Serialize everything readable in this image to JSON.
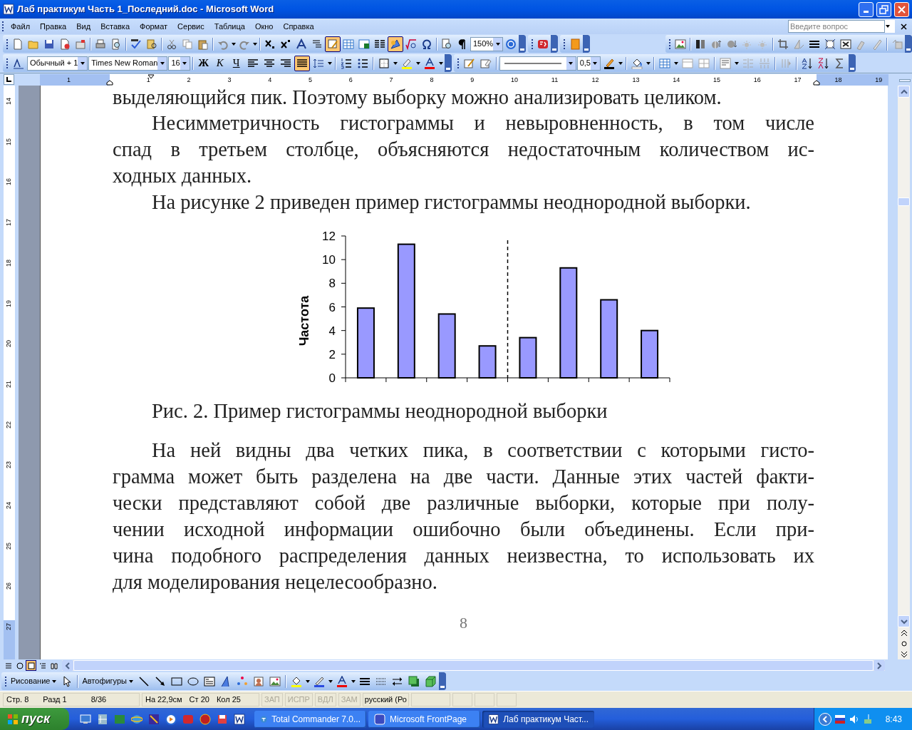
{
  "window": {
    "title": "Лаб практикум Часть 1_Последний.doc - Microsoft Word"
  },
  "menu": [
    {
      "label": "Файл"
    },
    {
      "label": "Правка"
    },
    {
      "label": "Вид"
    },
    {
      "label": "Вставка"
    },
    {
      "label": "Формат"
    },
    {
      "label": "Сервис"
    },
    {
      "label": "Таблица"
    },
    {
      "label": "Окно"
    },
    {
      "label": "Справка"
    }
  ],
  "help_search": {
    "placeholder": "Введите вопрос"
  },
  "standard_toolbar": {
    "zoom": "150%",
    "tables_and_borders_pressed": true,
    "drawing_pressed": true
  },
  "formatting_toolbar": {
    "style": "Обычный + 1",
    "font": "Times New Roman",
    "size": "16",
    "bold": "Ж",
    "italic": "К",
    "underline": "Ч",
    "justify_pressed": true
  },
  "tables_toolbar": {
    "line_weight": "0,5"
  },
  "ruler": {
    "horizontal": [
      "1",
      "1",
      "2",
      "3",
      "4",
      "5",
      "6",
      "7",
      "8",
      "9",
      "10",
      "11",
      "12",
      "13",
      "14",
      "15",
      "16",
      "17",
      "18",
      "19"
    ],
    "vertical": [
      "14",
      "15",
      "16",
      "17",
      "18",
      "19",
      "20",
      "21",
      "22",
      "23",
      "24",
      "25",
      "26",
      "27"
    ]
  },
  "document": {
    "paragraphs_before": [
      {
        "indent": false,
        "lines": [
          "выделяющийся пик. Поэтому выборку можно анализировать целиком."
        ]
      },
      {
        "indent": true,
        "lines": [
          "Несимметричность гистограммы и невыровненность, в том числе",
          "спад в третьем столбце, объясняются недостаточным количеством ис-",
          "ходных данных."
        ]
      },
      {
        "indent": true,
        "lines": [
          "На рисунке 2 приведен пример гистограммы неоднородной выборки."
        ]
      }
    ],
    "chart_data": {
      "type": "bar",
      "ylabel": "Частота",
      "values": [
        5.9,
        11.3,
        5.4,
        2.7,
        3.4,
        9.3,
        6.6,
        4.0
      ],
      "ylim": [
        0,
        12
      ],
      "yticks": [
        0,
        2,
        4,
        6,
        8,
        10,
        12
      ]
    },
    "caption": "Рис. 2. Пример гистограммы неоднородной выборки",
    "paragraphs_after": [
      {
        "indent": true,
        "lines": [
          "На ней видны два четких пика, в соответствии с которыми гисто-",
          "грамма может быть разделена на две части. Данные этих частей факти-",
          "чески представляют собой две различные выборки, которые при полу-",
          "чении исходной информации ошибочно были объединены. Если при-",
          "чина подобного распределения данных неизвестна, то использовать их",
          "для моделирования нецелесообразно."
        ]
      }
    ],
    "page_number": "8"
  },
  "view_buttons": [
    {
      "selected": false
    },
    {
      "selected": false
    },
    {
      "selected": true
    },
    {
      "selected": false
    },
    {
      "selected": false
    }
  ],
  "drawing_toolbar": {
    "draw_menu": "Рисование",
    "autoshapes": "Автофигуры"
  },
  "status_bar": {
    "position": [
      "Стр. 8",
      "Разд 1",
      "8/36"
    ],
    "cursor": [
      "На 22,9см",
      "Ст 20",
      "Кол 25"
    ],
    "modes": [
      {
        "label": "ЗАП",
        "on": false
      },
      {
        "label": "ИСПР",
        "on": false
      },
      {
        "label": "ВДЛ",
        "on": false
      },
      {
        "label": "ЗАМ",
        "on": false
      }
    ],
    "language": "русский (Ро"
  },
  "taskbar": {
    "start": "пуск",
    "tasks": [
      {
        "label": "Total Commander 7.0...",
        "selected": false
      },
      {
        "label": "Microsoft FrontPage",
        "selected": false
      },
      {
        "label": "Лаб практикум Част...",
        "selected": true
      }
    ],
    "clock": "8:43"
  }
}
